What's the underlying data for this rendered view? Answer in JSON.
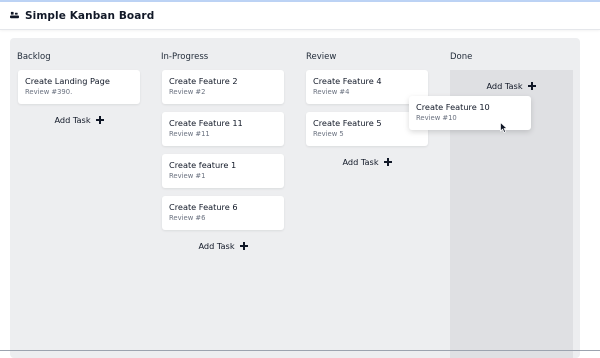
{
  "header": {
    "title": "Simple Kanban Board",
    "logo_icon": "kanban-logo-icon"
  },
  "columns": [
    {
      "title": "Backlog",
      "cards": [
        {
          "title": "Create Landing Page",
          "subtitle": "Review #390."
        }
      ],
      "add_label": "Add Task"
    },
    {
      "title": "In-Progress",
      "cards": [
        {
          "title": "Create Feature 2",
          "subtitle": "Review #2"
        },
        {
          "title": "Create Feature 11",
          "subtitle": "Review #11"
        },
        {
          "title": "Create feature 1",
          "subtitle": "Review #1"
        },
        {
          "title": "Create Feature 6",
          "subtitle": "Review #6"
        }
      ],
      "add_label": "Add Task"
    },
    {
      "title": "Review",
      "cards": [
        {
          "title": "Create Feature 4",
          "subtitle": "Review #4"
        },
        {
          "title": "Create Feature 5",
          "subtitle": "Review 5"
        }
      ],
      "add_label": "Add Task"
    },
    {
      "title": "Done",
      "cards": [],
      "add_label": "Add Task"
    }
  ],
  "dragging_card": {
    "title": "Create Feature 10",
    "subtitle": "Review #10"
  },
  "colors": {
    "board_bg": "#edeef0",
    "dropzone_bg": "#dfe0e3",
    "card_bg": "#ffffff",
    "text": "#111827",
    "muted": "#6b7280"
  },
  "icons": {
    "add": "plus-icon",
    "cursor": "mouse-pointer-icon"
  }
}
